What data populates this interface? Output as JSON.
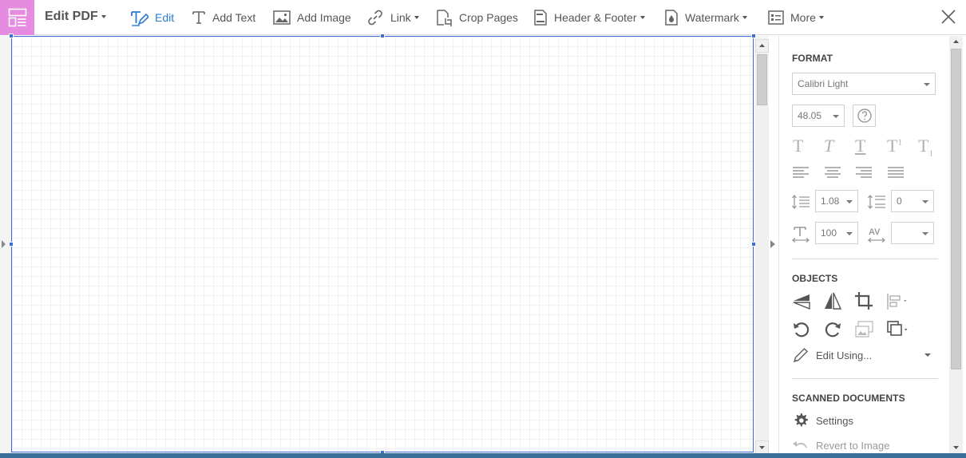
{
  "toolbar": {
    "title": "Edit PDF",
    "buttons": {
      "edit": "Edit",
      "add_text": "Add Text",
      "add_image": "Add Image",
      "link": "Link",
      "crop_pages": "Crop Pages",
      "header_footer": "Header & Footer",
      "watermark": "Watermark",
      "more": "More"
    },
    "accent_color": "#2b7bd3",
    "app_icon_color": "#e58ce0"
  },
  "panel": {
    "format": {
      "title": "FORMAT",
      "font_family": "Calibri Light",
      "font_size": "48.05",
      "line_spacing": "1.08",
      "paragraph_spacing": "0",
      "horizontal_scaling": "100",
      "character_spacing": ""
    },
    "objects": {
      "title": "OBJECTS",
      "edit_using": "Edit Using..."
    },
    "scanned": {
      "title": "SCANNED DOCUMENTS",
      "settings": "Settings",
      "revert": "Revert to Image"
    }
  },
  "selection_color": "#3c6fd1"
}
